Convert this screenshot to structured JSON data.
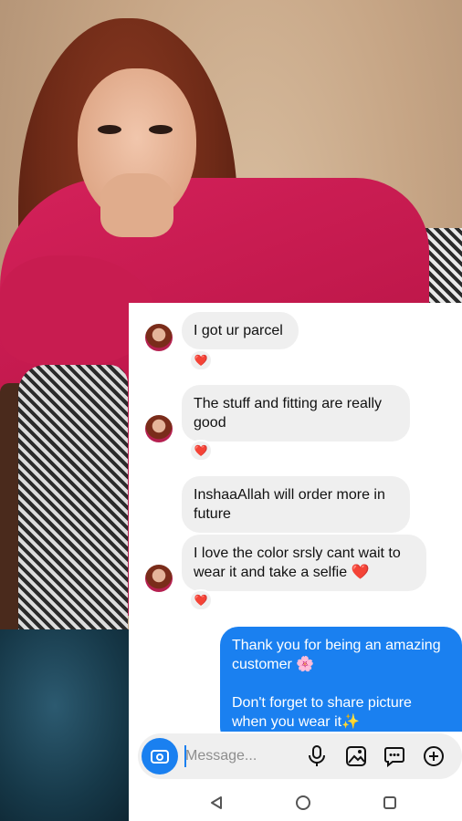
{
  "conversation": {
    "messages": [
      {
        "from": "them",
        "text": "I got ur parcel",
        "reaction": "❤️"
      },
      {
        "from": "them",
        "text": "The stuff and fitting are really good",
        "reaction": "❤️"
      },
      {
        "from": "them",
        "text": "InshaaAllah will order more in future"
      },
      {
        "from": "them",
        "text": "I love the color srsly cant wait to wear it and take a selfie ❤️",
        "reaction": "❤️"
      },
      {
        "from": "me",
        "text": "Thank you for being an amazing customer 🌸\n\nDon't forget to share picture when you wear it✨"
      }
    ]
  },
  "composer": {
    "placeholder": "Message...",
    "icons": [
      "camera-icon",
      "microphone-icon",
      "gallery-icon",
      "sticker-icon",
      "add-icon"
    ]
  },
  "navbar": {
    "icons": [
      "back-icon",
      "home-icon",
      "recents-icon"
    ]
  },
  "colors": {
    "accent": "#1a80f0",
    "received_bubble": "#efefef",
    "heart": "#e8233a"
  }
}
